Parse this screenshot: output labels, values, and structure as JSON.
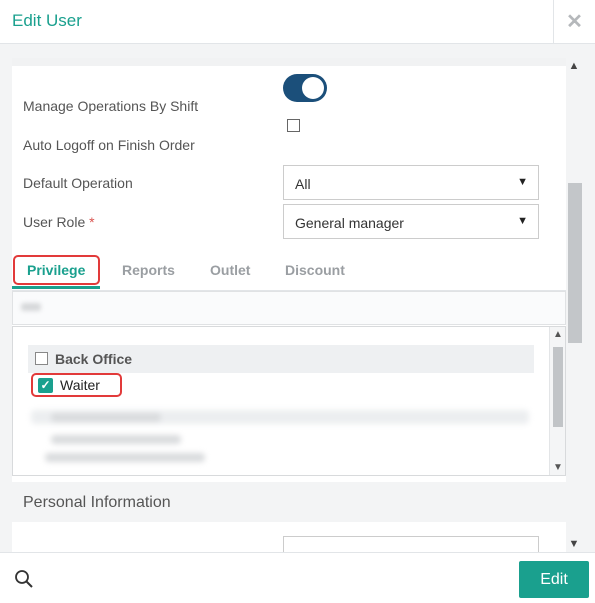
{
  "dialog": {
    "title": "Edit User",
    "close_symbol": "✕"
  },
  "form": {
    "manage_ops_label": "Manage Operations By Shift",
    "manage_ops_enabled": true,
    "auto_logoff_label": "Auto Logoff on Finish Order",
    "auto_logoff_checked": false,
    "default_operation_label": "Default Operation",
    "default_operation_value": "All",
    "user_role_label": "User Role",
    "user_role_required": "*",
    "user_role_value": "General manager"
  },
  "tabs": [
    {
      "label": "Privilege",
      "active": true
    },
    {
      "label": "Reports",
      "active": false
    },
    {
      "label": "Outlet",
      "active": false
    },
    {
      "label": "Discount",
      "active": false
    }
  ],
  "privileges": {
    "group_label": "Back Office",
    "group_checked": false,
    "item_label": "Waiter",
    "item_checked": true
  },
  "section": {
    "personal_info": "Personal Information"
  },
  "footer": {
    "edit_label": "Edit"
  },
  "icons": {
    "caret": "▼",
    "check": "✓",
    "scroll_up": "▲",
    "scroll_down": "▼"
  },
  "colors": {
    "accent": "#1aa08e",
    "toggle_on": "#1b4f7a",
    "highlight": "#e23a3a"
  }
}
